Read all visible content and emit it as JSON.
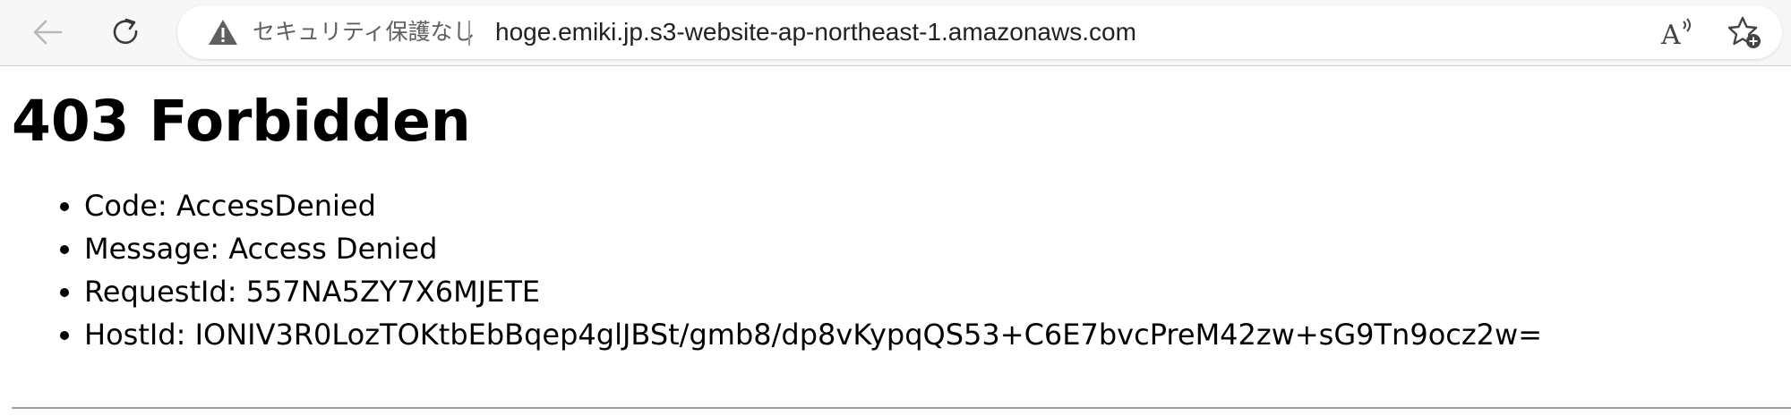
{
  "toolbar": {
    "back_icon": "arrow-left-icon",
    "reload_icon": "refresh-icon",
    "security_label": "セキュリティ保護なし",
    "url": "hoge.emiki.jp.s3-website-ap-northeast-1.amazonaws.com",
    "read_aloud_icon": "read-aloud-icon",
    "favorite_icon": "star-add-icon",
    "warning_color": "#5f5f5f"
  },
  "page": {
    "title": "403 Forbidden",
    "details": [
      "Code: AccessDenied",
      "Message: Access Denied",
      "RequestId: 557NA5ZY7X6MJETE",
      "HostId: IONIV3R0LozTOKtbEbBqep4glJBSt/gmb8/dp8vKypqQS53+C6E7bvcPreM42zw+sG9Tn9ocz2w="
    ]
  }
}
